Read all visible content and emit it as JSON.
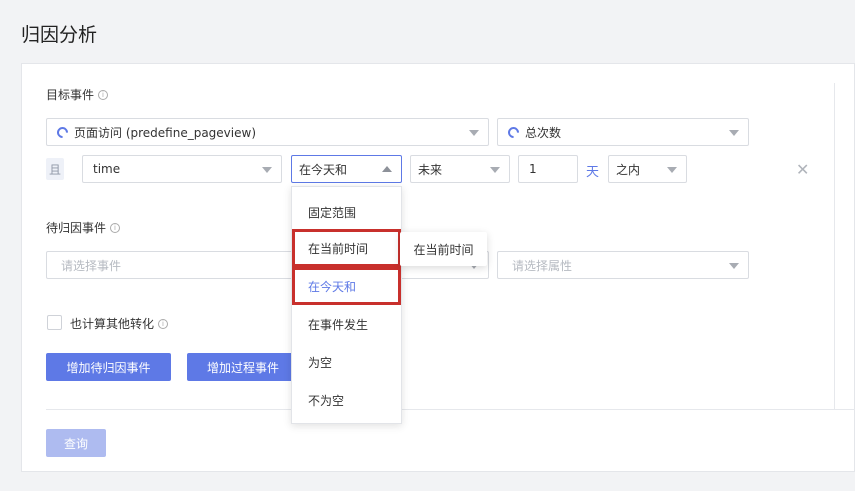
{
  "page": {
    "title": "归因分析"
  },
  "target_event": {
    "label": "目标事件",
    "event_select": "页面访问 (predefine_pageview)",
    "metric_select": "总次数",
    "filter": {
      "and_label": "且",
      "property": "time",
      "operator": "在今天和",
      "direction": "未来",
      "amount": "1",
      "unit": "天",
      "range": "之内"
    }
  },
  "attribution_event": {
    "label": "待归因事件",
    "event_placeholder": "请选择事件",
    "property_placeholder": "请选择属性"
  },
  "also_count": {
    "label": "也计算其他转化"
  },
  "buttons": {
    "add_attribution": "增加待归因事件",
    "add_process": "增加过程事件",
    "query": "查询"
  },
  "operator_dropdown": {
    "options": [
      "固定范围",
      "在当前时间",
      "在今天和",
      "在事件发生",
      "为空",
      "不为空"
    ],
    "selected": "在今天和",
    "tooltip": "在当前时间"
  },
  "colors": {
    "accent": "#5e79e6",
    "highlight_box": "#c8302c"
  }
}
